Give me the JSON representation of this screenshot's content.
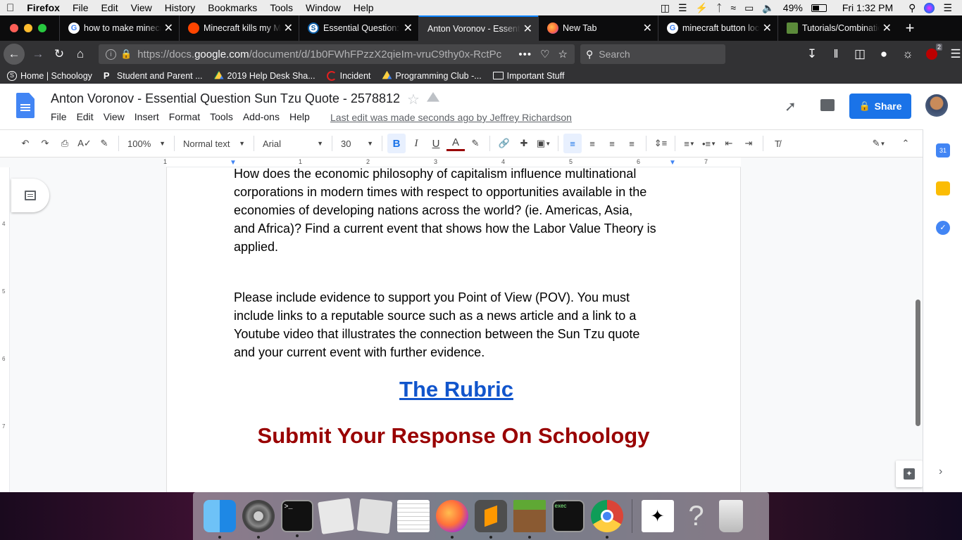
{
  "menubar": {
    "app": "Firefox",
    "items": [
      "File",
      "Edit",
      "View",
      "History",
      "Bookmarks",
      "Tools",
      "Window",
      "Help"
    ],
    "battery": "49%",
    "clock": "Fri 1:32 PM"
  },
  "tabs": [
    {
      "title": "how to make minecraft",
      "icon": "google-icon",
      "active": false
    },
    {
      "title": "Minecraft kills my Mac",
      "icon": "reddit-icon",
      "active": false
    },
    {
      "title": "Essential Question: Sun",
      "icon": "schoology-icon",
      "active": false
    },
    {
      "title": "Anton Voronov - Essential",
      "icon": "docs-icon",
      "active": true
    },
    {
      "title": "New Tab",
      "icon": "firefox-icon",
      "active": false
    },
    {
      "title": "minecraft button lock",
      "icon": "google-icon",
      "active": false
    },
    {
      "title": "Tutorials/Combination",
      "icon": "minecraft-wiki-icon",
      "active": false
    }
  ],
  "nav": {
    "url_prefix": "https://docs.",
    "url_domain": "google.com",
    "url_rest": "/document/d/1b0FWhFPzzX2qieIm-vruC9thy0x-RctPc",
    "search_placeholder": "Search",
    "badge_count": "2"
  },
  "bookmarks": [
    {
      "label": "Home | Schoology",
      "icon": "schoology-icon"
    },
    {
      "label": "Student and Parent ...",
      "icon": "p-icon"
    },
    {
      "label": "2019 Help Desk Sha...",
      "icon": "drive-icon"
    },
    {
      "label": "Incident",
      "icon": "incident-icon"
    },
    {
      "label": "Programming Club -...",
      "icon": "drive-icon"
    },
    {
      "label": "Important Stuff",
      "icon": "folder-icon"
    }
  ],
  "doc": {
    "title": "Anton Voronov - Essential Question Sun Tzu Quote - 2578812",
    "menu": [
      "File",
      "Edit",
      "View",
      "Insert",
      "Format",
      "Tools",
      "Add-ons",
      "Help"
    ],
    "last_edit": "Last edit was made seconds ago by Jeffrey Richardson",
    "share_label": "Share"
  },
  "toolbar": {
    "zoom": "100%",
    "style": "Normal text",
    "font": "Arial",
    "size": "30"
  },
  "ruler": {
    "h_ticks": [
      "1",
      "1",
      "2",
      "3",
      "4",
      "5",
      "6",
      "7"
    ],
    "v_ticks": [
      "4",
      "5",
      "6",
      "7"
    ]
  },
  "content": {
    "para1": [
      "How does the economic philosophy of capitalism influence multinational",
      "corporations in modern times with respect to opportunities available in the",
      "economies of developing nations across the world? (ie. Americas, Asia,",
      "and Africa)? Find a current event that shows how the Labor Value Theory is",
      "applied."
    ],
    "para2": [
      "Please include evidence to support you Point of View (POV). You must",
      "include links to a reputable source such as a news article and a link to a",
      "Youtube video that illustrates the connection between the Sun Tzu quote",
      "and your current event with further evidence."
    ],
    "rubric_link": "The Rubric",
    "submit_heading": "Submit Your Response On Schoology"
  },
  "colors": {
    "link": "#1155cc",
    "heading_red": "#990000",
    "share_blue": "#1a73e8",
    "active_tab_accent": "#0a84ff"
  },
  "dock": [
    {
      "name": "finder-icon"
    },
    {
      "name": "system-preferences-icon"
    },
    {
      "name": "terminal-icon"
    },
    {
      "name": "script-editor-icon"
    },
    {
      "name": "script-editor-2-icon"
    },
    {
      "name": "textedit-icon"
    },
    {
      "name": "firefox-icon"
    },
    {
      "name": "sublime-text-icon"
    },
    {
      "name": "minecraft-icon"
    },
    {
      "name": "exec-icon",
      "label": "exec"
    },
    {
      "name": "chrome-icon"
    },
    {
      "name": "grapher-icon"
    },
    {
      "name": "help-icon"
    },
    {
      "name": "trash-icon"
    }
  ]
}
